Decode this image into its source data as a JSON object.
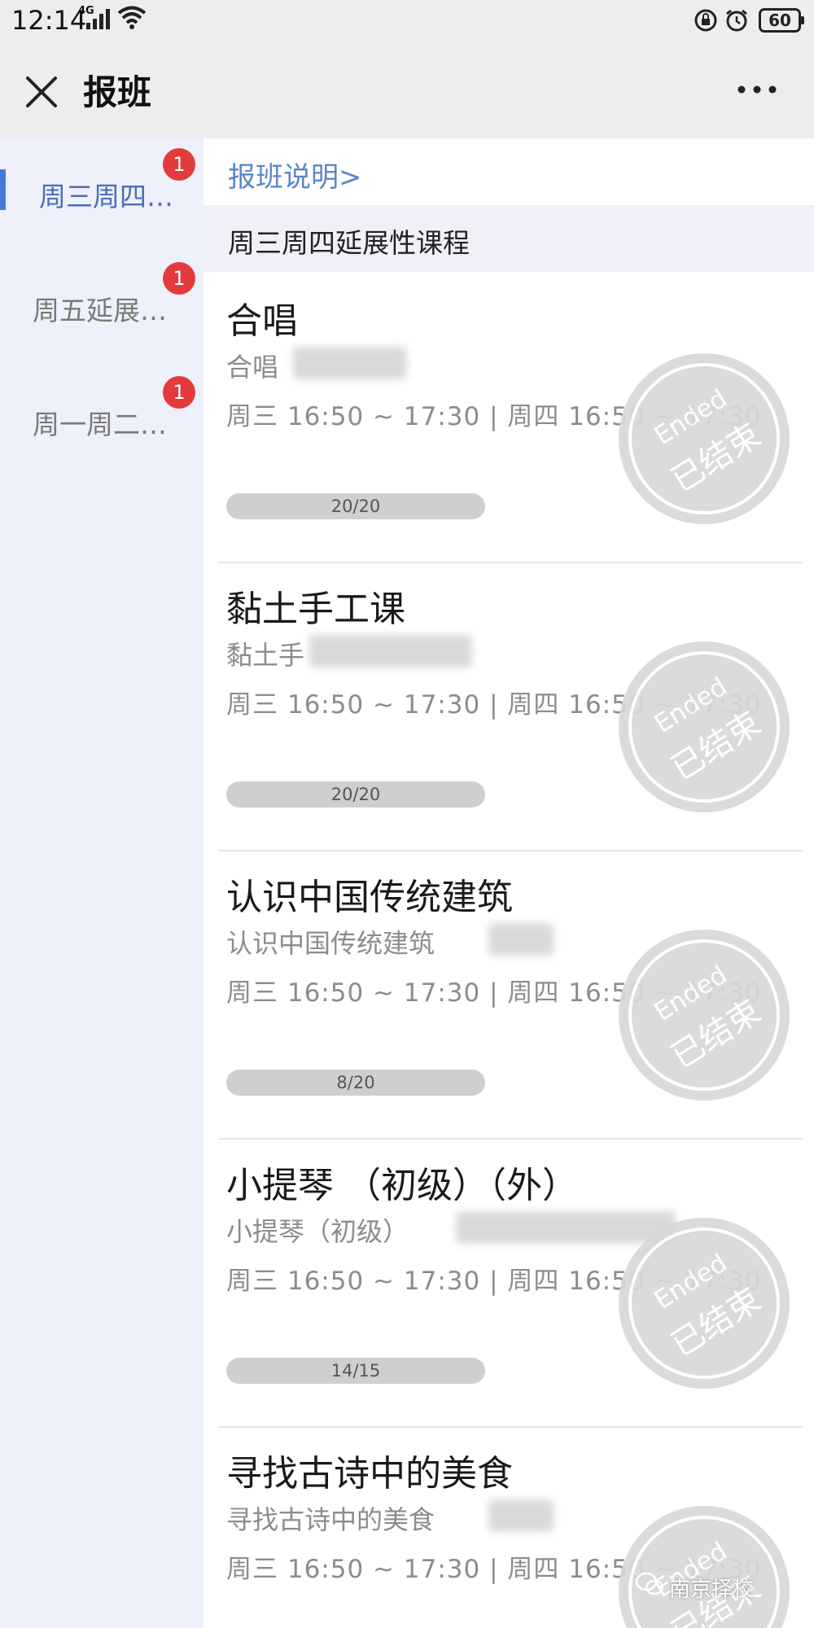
{
  "status_bar": {
    "time": "12:14",
    "network": "4G",
    "battery": "60"
  },
  "nav": {
    "title": "报班"
  },
  "sidebar": {
    "items": [
      {
        "label": "周三周四…",
        "badge": "1",
        "active": true
      },
      {
        "label": "周五延展…",
        "badge": "1",
        "active": false
      },
      {
        "label": "周一周二…",
        "badge": "1",
        "active": false
      }
    ]
  },
  "main": {
    "notice_link": "报班说明>",
    "group_title": "周三周四延展性课程",
    "courses": [
      {
        "title": "合唱",
        "subtitle": "合唱",
        "schedule": "周三 16:50 ~ 17:30 | 周四 16:50 ~ 17:30",
        "enrollment": "20/20",
        "stamp_en": "Ended",
        "stamp_zh": "已结束"
      },
      {
        "title": "黏土手工课",
        "subtitle": "黏土手",
        "schedule": "周三 16:50 ~ 17:30 | 周四 16:50 ~ 17:30",
        "enrollment": "20/20",
        "stamp_en": "Ended",
        "stamp_zh": "已结束"
      },
      {
        "title": "认识中国传统建筑",
        "subtitle": "认识中国传统建筑",
        "schedule": "周三 16:50 ~ 17:30 | 周四 16:50 ~ 17:30",
        "enrollment": "8/20",
        "stamp_en": "Ended",
        "stamp_zh": "已结束"
      },
      {
        "title": "小提琴 （初级）（外）",
        "subtitle": "小提琴（初级）",
        "schedule": "周三 16:50 ~ 17:30 | 周四 16:50 ~ 17:30",
        "enrollment": "14/15",
        "stamp_en": "Ended",
        "stamp_zh": "已结束"
      },
      {
        "title": "寻找古诗中的美食",
        "subtitle": "寻找古诗中的美食",
        "schedule": "周三 16:50 ~ 17:30 | 周四 16:50 ~ 17:30",
        "enrollment": "",
        "stamp_en": "Ended",
        "stamp_zh": "已结束"
      }
    ]
  },
  "watermark": "南京择校",
  "colors": {
    "accent": "#4a78d8",
    "link": "#5a86c8",
    "badge": "#e33b3b",
    "sidebar_bg": "#eef0fb"
  }
}
